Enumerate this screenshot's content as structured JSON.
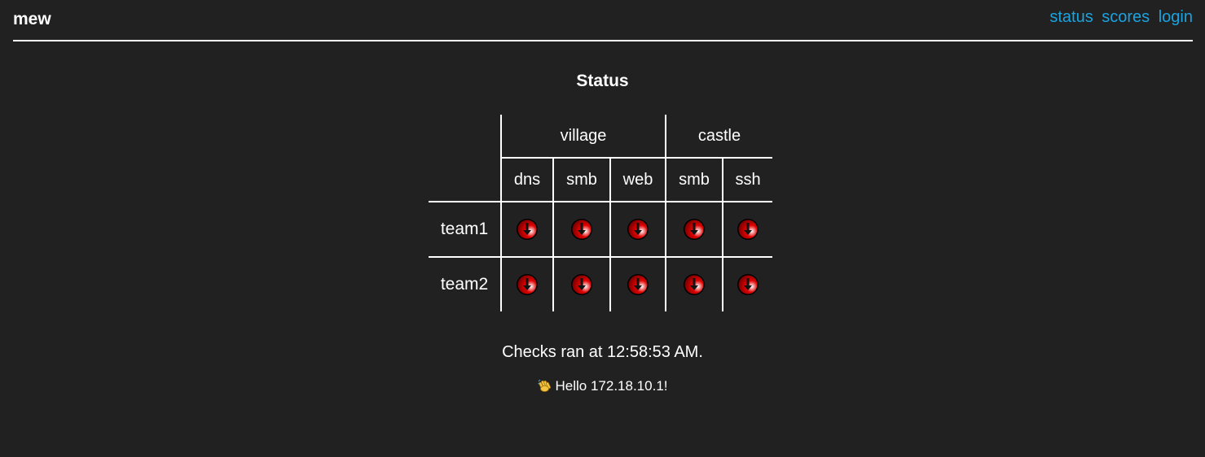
{
  "header": {
    "brand": "mew",
    "nav": [
      "status",
      "scores",
      "login"
    ]
  },
  "page_title": "Status",
  "table": {
    "groups": [
      "village",
      "castle"
    ],
    "services": [
      "dns",
      "smb",
      "web",
      "smb",
      "ssh"
    ],
    "teams": [
      {
        "name": "team1",
        "statuses": [
          "down",
          "down",
          "down",
          "down",
          "down"
        ]
      },
      {
        "name": "team2",
        "statuses": [
          "down",
          "down",
          "down",
          "down",
          "down"
        ]
      }
    ]
  },
  "checks_text": "Checks ran at 12:58:53 AM.",
  "hello_text": "Hello 172.18.10.1!",
  "icons": {
    "status_down": "down-arrow-icon",
    "greeting": "waving-hand-icon"
  },
  "colors": {
    "background": "#212121",
    "link": "#1aa3e0",
    "status_down": "#e00000"
  }
}
